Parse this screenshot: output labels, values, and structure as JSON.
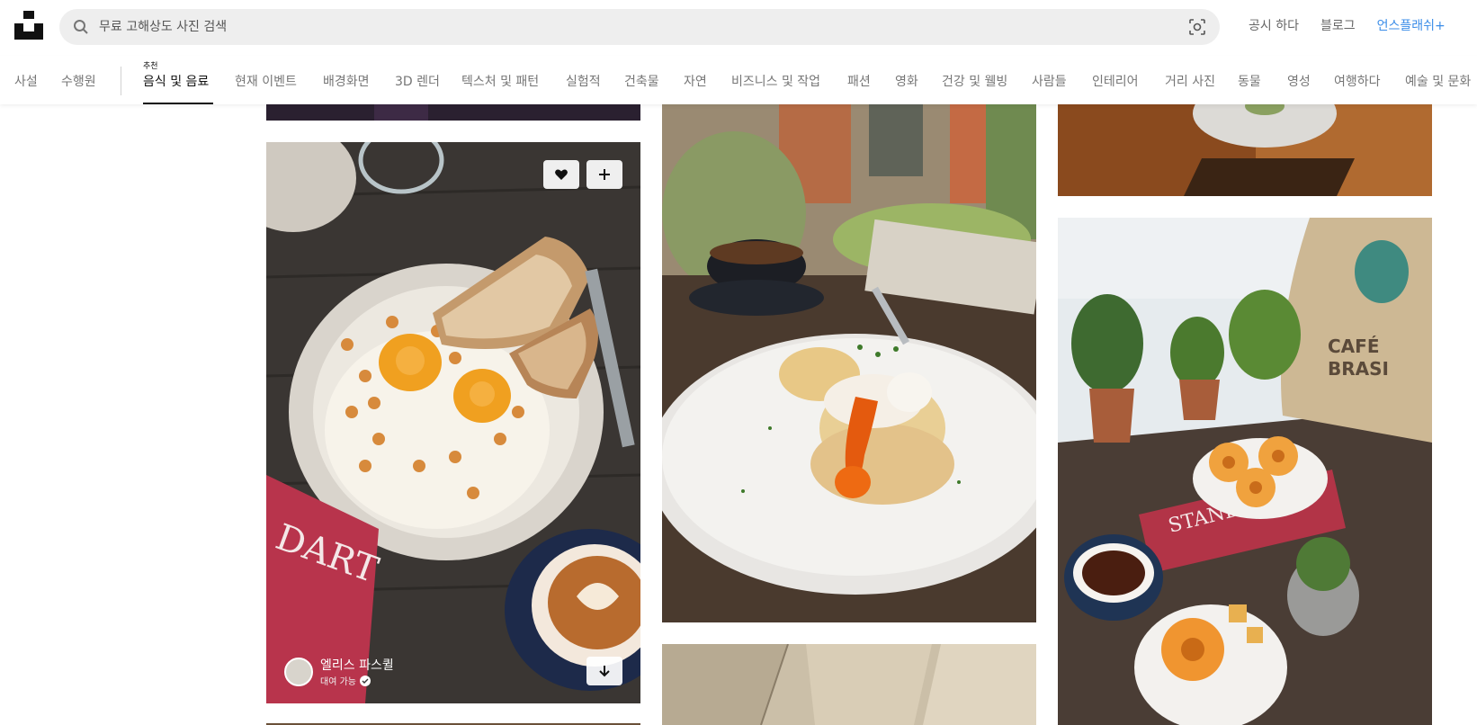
{
  "header": {
    "search_placeholder": "무료 고해상도 사진 검색",
    "links": [
      "공시 하다",
      "블로그",
      "언스플래쉬+"
    ]
  },
  "nav": {
    "left_items": [
      "사설",
      "수행원"
    ],
    "featured_sub": "추천",
    "active": "음식 및 음료",
    "items": [
      "현재 이벤트",
      "배경화면",
      "3D 렌더",
      "텍스처 및 패턴",
      "실험적",
      "건축물",
      "자연",
      "비즈니스 및 작업",
      "패션",
      "영화",
      "건강 및 웰빙",
      "사람들",
      "인테리어",
      "거리 사진",
      "동물",
      "영성",
      "여행하다",
      "예술 및 문화"
    ]
  },
  "featured_photo": {
    "author_name": "엘리스 파스퀼",
    "author_status": "대여 가능",
    "icons": [
      "heart-icon",
      "plus-icon",
      "download-icon"
    ]
  },
  "colors": {
    "accent_link": "#3b8de8",
    "search_bg": "#eeeeee",
    "nav_inactive": "#767676"
  }
}
